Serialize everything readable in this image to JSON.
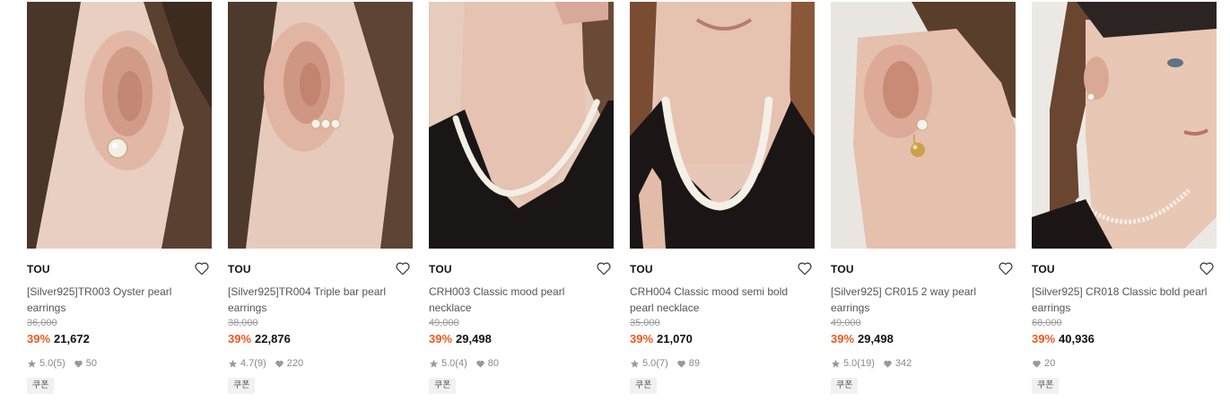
{
  "products": [
    {
      "brand": "TOU",
      "name": "[Silver925]TR003 Oyster pearl earrings",
      "original_price": "36,000",
      "discount": "39%",
      "price": "21,672",
      "rating": "5.0",
      "review_count": "(5)",
      "likes": "50",
      "coupon": "쿠폰",
      "image": "ear-with-oyster-pearl-earring"
    },
    {
      "brand": "TOU",
      "name": "[Silver925]TR004 Triple bar pearl earrings",
      "original_price": "38,000",
      "discount": "39%",
      "price": "22,876",
      "rating": "4.7",
      "review_count": "(9)",
      "likes": "220",
      "coupon": "쿠폰",
      "image": "ear-with-triple-pearl-bar-earring"
    },
    {
      "brand": "TOU",
      "name": "CRH003 Classic mood pearl necklace",
      "original_price": "49,000",
      "discount": "39%",
      "price": "29,498",
      "rating": "5.0",
      "review_count": "(4)",
      "likes": "80",
      "coupon": "쿠폰",
      "image": "neck-with-pearl-necklace"
    },
    {
      "brand": "TOU",
      "name": "CRH004 Classic mood semi bold pearl necklace",
      "original_price": "35,000",
      "discount": "39%",
      "price": "21,070",
      "rating": "5.0",
      "review_count": "(7)",
      "likes": "89",
      "coupon": "쿠폰",
      "image": "neck-with-semi-bold-pearl-necklace"
    },
    {
      "brand": "TOU",
      "name": "[Silver925] CR015 2 way pearl earrings",
      "original_price": "49,000",
      "discount": "39%",
      "price": "29,498",
      "rating": "5.0",
      "review_count": "(19)",
      "likes": "342",
      "coupon": "쿠폰",
      "image": "ear-with-2-way-pearl-earring"
    },
    {
      "brand": "TOU",
      "name": "[Silver925] CR018 Classic bold pearl earrings",
      "original_price": "68,000",
      "discount": "39%",
      "price": "40,936",
      "rating": "",
      "review_count": "",
      "likes": "20",
      "coupon": "쿠폰",
      "image": "model-profile-with-pearl-earring"
    }
  ],
  "colors": {
    "discount": "#f0571d",
    "price": "#111111",
    "muted": "#999999"
  }
}
